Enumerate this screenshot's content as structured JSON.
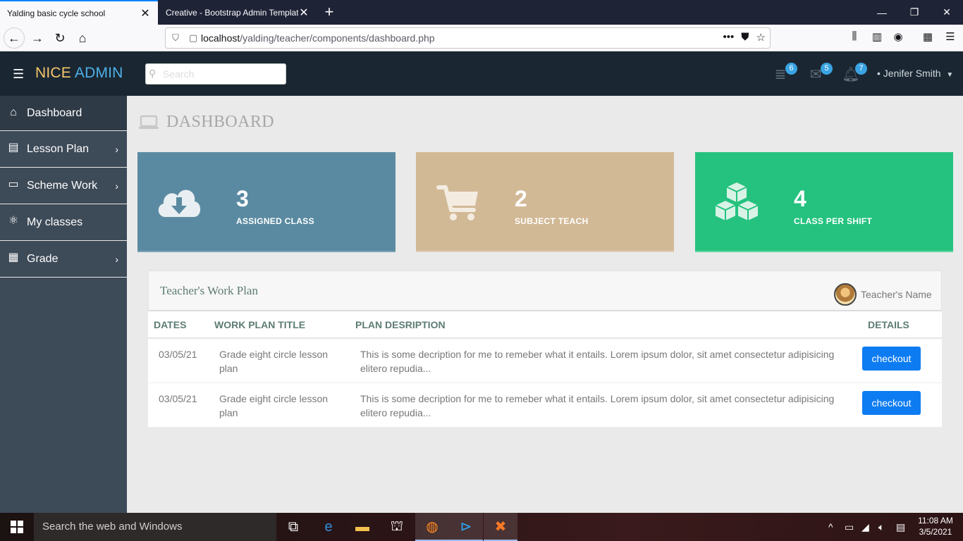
{
  "browser": {
    "tabs": [
      {
        "title": "Yalding basic cycle school",
        "active": true
      },
      {
        "title": "Creative - Bootstrap Admin Template",
        "active": false
      }
    ],
    "url": {
      "host": "localhost",
      "path": "/yalding/teacher/components/dashboard.php"
    }
  },
  "header": {
    "brand_part1": "NICE",
    "brand_part2": "ADMIN",
    "search_placeholder": "Search",
    "badges": {
      "tasks": "6",
      "mail": "5",
      "notifications": "7"
    },
    "user_name": "Jenifer Smith"
  },
  "sidebar": {
    "items": [
      {
        "label": "Dashboard",
        "icon": "home-icon",
        "has_submenu": false,
        "active": true
      },
      {
        "label": "Lesson Plan",
        "icon": "document-icon",
        "has_submenu": true
      },
      {
        "label": "Scheme Work",
        "icon": "desktop-icon",
        "has_submenu": true
      },
      {
        "label": "My classes",
        "icon": "atom-icon",
        "has_submenu": false
      },
      {
        "label": "Grade",
        "icon": "table-icon",
        "has_submenu": true
      }
    ]
  },
  "page": {
    "title": "DASHBOARD"
  },
  "stats": [
    {
      "value": "3",
      "label": "ASSIGNED CLASS",
      "icon": "cloud-download-icon",
      "color": "#5a8aa1"
    },
    {
      "value": "2",
      "label": "SUBJECT TEACH",
      "icon": "shopping-cart-icon",
      "color": "#d2b996"
    },
    {
      "value": "4",
      "label": "CLASS PER SHIFT",
      "icon": "cubes-icon",
      "color": "#25c27f"
    }
  ],
  "workplan": {
    "title": "Teacher's Work Plan",
    "teacher_label": "Teacher's Name",
    "columns": [
      "DATES",
      "WORK PLAN TITLE",
      "PLAN DESRIPTION",
      "DETAILS"
    ],
    "rows": [
      {
        "date": "03/05/21",
        "title": "Grade eight circle lesson plan",
        "description": "This is some decription for me to remeber what it entails. Lorem ipsum dolor, sit amet consectetur adipisicing elitero repudia...",
        "action": "checkout"
      },
      {
        "date": "03/05/21",
        "title": "Grade eight circle lesson plan",
        "description": "This is some decription for me to remeber what it entails. Lorem ipsum dolor, sit amet consectetur adipisicing elitero repudia...",
        "action": "checkout"
      }
    ]
  },
  "taskbar": {
    "search_placeholder": "Search the web and Windows",
    "time": "11:08 AM",
    "date": "3/5/2021"
  }
}
